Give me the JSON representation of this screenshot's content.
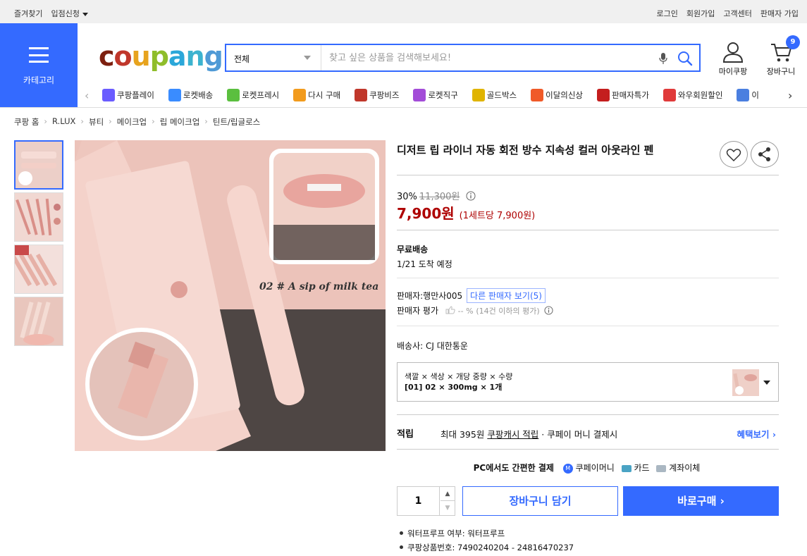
{
  "topbar": {
    "bookmark": "즐겨찾기",
    "seller_apply": "입점신청",
    "right_links": [
      "로그인",
      "회원가입",
      "고객센터",
      "판매자 가입"
    ]
  },
  "header": {
    "category_label": "카테고리",
    "logo_text": "coupang",
    "search_category": "전체",
    "search_placeholder": "찾고 싶은 상품을 검색해보세요!",
    "mypage": "마이쿠팡",
    "cart": "장바구니",
    "cart_count": "9",
    "brand_color": "#346aff"
  },
  "category_strip": [
    {
      "label": "쿠팡플레이",
      "icon": "play-icon",
      "color": "#6a5cff"
    },
    {
      "label": "로켓배송",
      "icon": "rocket-icon",
      "color": "#3a8cff"
    },
    {
      "label": "로켓프레시",
      "icon": "rocket-fresh-icon",
      "color": "#5bbf3f"
    },
    {
      "label": "다시 구매",
      "icon": "basket-icon",
      "color": "#f29b1d"
    },
    {
      "label": "쿠팡비즈",
      "icon": "biz-icon",
      "color": "#c0372b"
    },
    {
      "label": "로켓직구",
      "icon": "globe-rocket-icon",
      "color": "#a34cd8"
    },
    {
      "label": "골드박스",
      "icon": "gold-box-icon",
      "color": "#e0b400"
    },
    {
      "label": "이달의신상",
      "icon": "new-bag-icon",
      "color": "#f05a28"
    },
    {
      "label": "판매자특가",
      "icon": "percent-icon",
      "color": "#c41e1e"
    },
    {
      "label": "와우회원할인",
      "icon": "wow-icon",
      "color": "#e03a3a"
    },
    {
      "label": "이",
      "icon": "coupon-icon",
      "color": "#4a7fe0"
    }
  ],
  "breadcrumb": [
    "쿠팡 홈",
    "R.LUX",
    "뷰티",
    "메이크업",
    "립 메이크업",
    "틴트/립글로스"
  ],
  "product": {
    "title": "디저트 립 라이너 자동 회전 방수 지속성 컬러 아웃라인 펜",
    "discount_rate": "30%",
    "original_price": "11,300원",
    "price": "7,900원",
    "unit_price": "(1세트당 7,900원)",
    "shipping_title": "무료배송",
    "arrival": "1/21 도착 예정",
    "seller_label": "판매자:",
    "seller_name": "행만사005",
    "other_sellers": "다른 판매자 보기(5)",
    "seller_rating_label": "판매자 평가",
    "seller_rating_value": "-- %",
    "seller_rating_note": "(14건 이하의 평가)",
    "carrier_label": "배송사:",
    "carrier": "CJ 대한통운",
    "option_header": "색깔 × 색상 × 개당 중량 × 수량",
    "option_value": "[01] 02 × 300mg × 1개",
    "image_caption": "02 # A sip of milk tea",
    "reward_label": "적립",
    "reward_text_1": "최대 395원",
    "reward_text_2": "쿠팡캐시 적립",
    "reward_text_3": "· 쿠페이 머니 결제시",
    "reward_more": "혜택보기",
    "pay_title": "PC에서도 간편한 결제",
    "pay_methods": [
      "쿠페이머니",
      "카드",
      "계좌이체"
    ],
    "quantity": "1",
    "add_to_cart": "장바구니 담기",
    "buy_now": "바로구매",
    "attributes": [
      "워터프루프 여부: 워터프루프",
      "쿠팡상품번호: 7490240204 - 24816470237"
    ]
  }
}
